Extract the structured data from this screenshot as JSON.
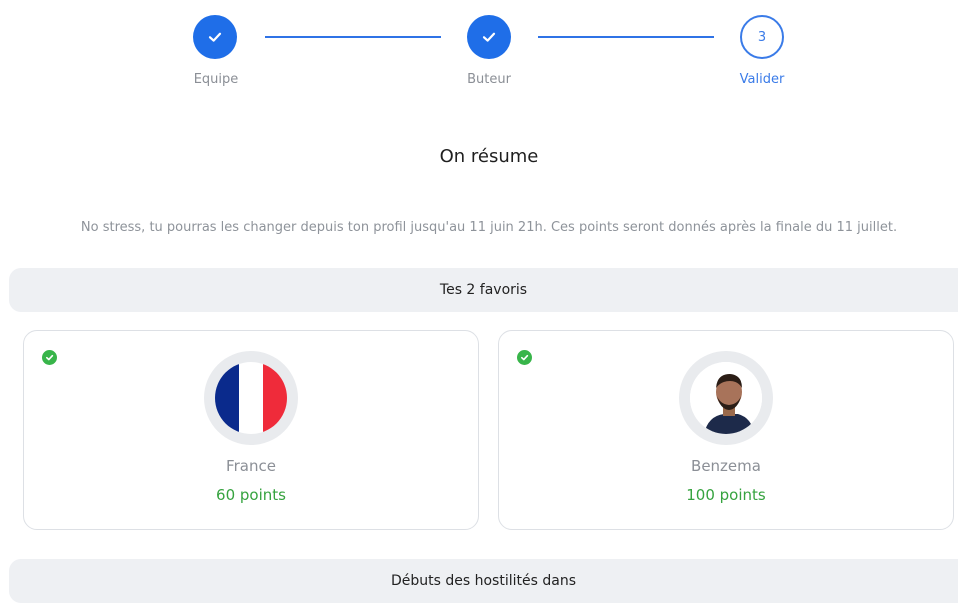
{
  "stepper": {
    "steps": [
      {
        "label": "Equipe",
        "state": "done",
        "icon": "check-icon"
      },
      {
        "label": "Buteur",
        "state": "done",
        "icon": "check-icon"
      },
      {
        "label": "Valider",
        "state": "current",
        "number": "3"
      }
    ],
    "colors": {
      "accent": "#1f6ee8",
      "line": "#2f73e6",
      "label": "#8b8f96"
    }
  },
  "summary": {
    "title": "On résume",
    "subtitle": "No stress, tu pourras les changer depuis ton profil jusqu'au 11 juin 21h. Ces points seront donnés après la finale du 11 juillet."
  },
  "favorites": {
    "header": "Tes 2 favoris",
    "cards": [
      {
        "name": "France",
        "points": "60 points",
        "selected": true,
        "image": "france-flag"
      },
      {
        "name": "Benzema",
        "points": "100 points",
        "selected": true,
        "image": "player-photo"
      }
    ],
    "colors": {
      "points": "#36a33f",
      "check": "#38b54a"
    }
  },
  "hostilities": {
    "header": "Débuts des hostilités dans"
  }
}
